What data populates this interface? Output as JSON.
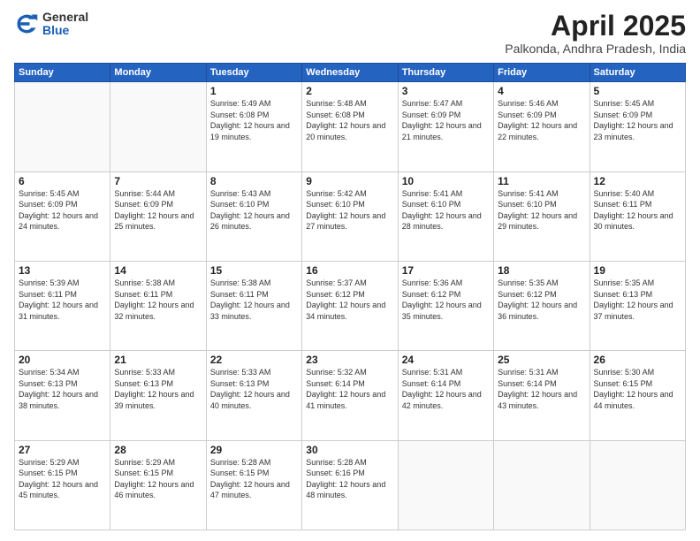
{
  "logo": {
    "general": "General",
    "blue": "Blue"
  },
  "header": {
    "month": "April 2025",
    "location": "Palkonda, Andhra Pradesh, India"
  },
  "weekdays": [
    "Sunday",
    "Monday",
    "Tuesday",
    "Wednesday",
    "Thursday",
    "Friday",
    "Saturday"
  ],
  "weeks": [
    [
      {
        "day": "",
        "sunrise": "",
        "sunset": "",
        "daylight": ""
      },
      {
        "day": "",
        "sunrise": "",
        "sunset": "",
        "daylight": ""
      },
      {
        "day": "1",
        "sunrise": "Sunrise: 5:49 AM",
        "sunset": "Sunset: 6:08 PM",
        "daylight": "Daylight: 12 hours and 19 minutes."
      },
      {
        "day": "2",
        "sunrise": "Sunrise: 5:48 AM",
        "sunset": "Sunset: 6:08 PM",
        "daylight": "Daylight: 12 hours and 20 minutes."
      },
      {
        "day": "3",
        "sunrise": "Sunrise: 5:47 AM",
        "sunset": "Sunset: 6:09 PM",
        "daylight": "Daylight: 12 hours and 21 minutes."
      },
      {
        "day": "4",
        "sunrise": "Sunrise: 5:46 AM",
        "sunset": "Sunset: 6:09 PM",
        "daylight": "Daylight: 12 hours and 22 minutes."
      },
      {
        "day": "5",
        "sunrise": "Sunrise: 5:45 AM",
        "sunset": "Sunset: 6:09 PM",
        "daylight": "Daylight: 12 hours and 23 minutes."
      }
    ],
    [
      {
        "day": "6",
        "sunrise": "Sunrise: 5:45 AM",
        "sunset": "Sunset: 6:09 PM",
        "daylight": "Daylight: 12 hours and 24 minutes."
      },
      {
        "day": "7",
        "sunrise": "Sunrise: 5:44 AM",
        "sunset": "Sunset: 6:09 PM",
        "daylight": "Daylight: 12 hours and 25 minutes."
      },
      {
        "day": "8",
        "sunrise": "Sunrise: 5:43 AM",
        "sunset": "Sunset: 6:10 PM",
        "daylight": "Daylight: 12 hours and 26 minutes."
      },
      {
        "day": "9",
        "sunrise": "Sunrise: 5:42 AM",
        "sunset": "Sunset: 6:10 PM",
        "daylight": "Daylight: 12 hours and 27 minutes."
      },
      {
        "day": "10",
        "sunrise": "Sunrise: 5:41 AM",
        "sunset": "Sunset: 6:10 PM",
        "daylight": "Daylight: 12 hours and 28 minutes."
      },
      {
        "day": "11",
        "sunrise": "Sunrise: 5:41 AM",
        "sunset": "Sunset: 6:10 PM",
        "daylight": "Daylight: 12 hours and 29 minutes."
      },
      {
        "day": "12",
        "sunrise": "Sunrise: 5:40 AM",
        "sunset": "Sunset: 6:11 PM",
        "daylight": "Daylight: 12 hours and 30 minutes."
      }
    ],
    [
      {
        "day": "13",
        "sunrise": "Sunrise: 5:39 AM",
        "sunset": "Sunset: 6:11 PM",
        "daylight": "Daylight: 12 hours and 31 minutes."
      },
      {
        "day": "14",
        "sunrise": "Sunrise: 5:38 AM",
        "sunset": "Sunset: 6:11 PM",
        "daylight": "Daylight: 12 hours and 32 minutes."
      },
      {
        "day": "15",
        "sunrise": "Sunrise: 5:38 AM",
        "sunset": "Sunset: 6:11 PM",
        "daylight": "Daylight: 12 hours and 33 minutes."
      },
      {
        "day": "16",
        "sunrise": "Sunrise: 5:37 AM",
        "sunset": "Sunset: 6:12 PM",
        "daylight": "Daylight: 12 hours and 34 minutes."
      },
      {
        "day": "17",
        "sunrise": "Sunrise: 5:36 AM",
        "sunset": "Sunset: 6:12 PM",
        "daylight": "Daylight: 12 hours and 35 minutes."
      },
      {
        "day": "18",
        "sunrise": "Sunrise: 5:35 AM",
        "sunset": "Sunset: 6:12 PM",
        "daylight": "Daylight: 12 hours and 36 minutes."
      },
      {
        "day": "19",
        "sunrise": "Sunrise: 5:35 AM",
        "sunset": "Sunset: 6:13 PM",
        "daylight": "Daylight: 12 hours and 37 minutes."
      }
    ],
    [
      {
        "day": "20",
        "sunrise": "Sunrise: 5:34 AM",
        "sunset": "Sunset: 6:13 PM",
        "daylight": "Daylight: 12 hours and 38 minutes."
      },
      {
        "day": "21",
        "sunrise": "Sunrise: 5:33 AM",
        "sunset": "Sunset: 6:13 PM",
        "daylight": "Daylight: 12 hours and 39 minutes."
      },
      {
        "day": "22",
        "sunrise": "Sunrise: 5:33 AM",
        "sunset": "Sunset: 6:13 PM",
        "daylight": "Daylight: 12 hours and 40 minutes."
      },
      {
        "day": "23",
        "sunrise": "Sunrise: 5:32 AM",
        "sunset": "Sunset: 6:14 PM",
        "daylight": "Daylight: 12 hours and 41 minutes."
      },
      {
        "day": "24",
        "sunrise": "Sunrise: 5:31 AM",
        "sunset": "Sunset: 6:14 PM",
        "daylight": "Daylight: 12 hours and 42 minutes."
      },
      {
        "day": "25",
        "sunrise": "Sunrise: 5:31 AM",
        "sunset": "Sunset: 6:14 PM",
        "daylight": "Daylight: 12 hours and 43 minutes."
      },
      {
        "day": "26",
        "sunrise": "Sunrise: 5:30 AM",
        "sunset": "Sunset: 6:15 PM",
        "daylight": "Daylight: 12 hours and 44 minutes."
      }
    ],
    [
      {
        "day": "27",
        "sunrise": "Sunrise: 5:29 AM",
        "sunset": "Sunset: 6:15 PM",
        "daylight": "Daylight: 12 hours and 45 minutes."
      },
      {
        "day": "28",
        "sunrise": "Sunrise: 5:29 AM",
        "sunset": "Sunset: 6:15 PM",
        "daylight": "Daylight: 12 hours and 46 minutes."
      },
      {
        "day": "29",
        "sunrise": "Sunrise: 5:28 AM",
        "sunset": "Sunset: 6:15 PM",
        "daylight": "Daylight: 12 hours and 47 minutes."
      },
      {
        "day": "30",
        "sunrise": "Sunrise: 5:28 AM",
        "sunset": "Sunset: 6:16 PM",
        "daylight": "Daylight: 12 hours and 48 minutes."
      },
      {
        "day": "",
        "sunrise": "",
        "sunset": "",
        "daylight": ""
      },
      {
        "day": "",
        "sunrise": "",
        "sunset": "",
        "daylight": ""
      },
      {
        "day": "",
        "sunrise": "",
        "sunset": "",
        "daylight": ""
      }
    ]
  ]
}
